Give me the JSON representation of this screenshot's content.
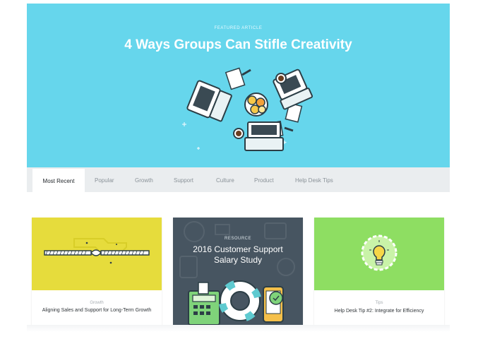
{
  "hero": {
    "kicker": "FEATURED ARTICLE",
    "title": "4 Ways Groups Can Stifle Creativity",
    "bg_color": "#66d6ec"
  },
  "tabs": [
    {
      "label": "Most Recent",
      "active": true
    },
    {
      "label": "Popular",
      "active": false
    },
    {
      "label": "Growth",
      "active": false
    },
    {
      "label": "Support",
      "active": false
    },
    {
      "label": "Culture",
      "active": false
    },
    {
      "label": "Product",
      "active": false
    },
    {
      "label": "Help Desk Tips",
      "active": false
    }
  ],
  "cards": [
    {
      "category": "Growth",
      "title": "Aligning Sales and Support for Long-Term Growth",
      "image_color": "#e6dc3c",
      "icon": "rope-icon"
    },
    {
      "overlay_label": "RESOURCE",
      "overlay_title": "2016 Customer Support Salary Study",
      "image_color": "#475561",
      "icon": "lifebuoy-calculator-icon"
    },
    {
      "category": "Tips",
      "title": "Help Desk Tip #2: Integrate for Efficiency",
      "image_color": "#8ede62",
      "icon": "lightbulb-icon"
    }
  ]
}
